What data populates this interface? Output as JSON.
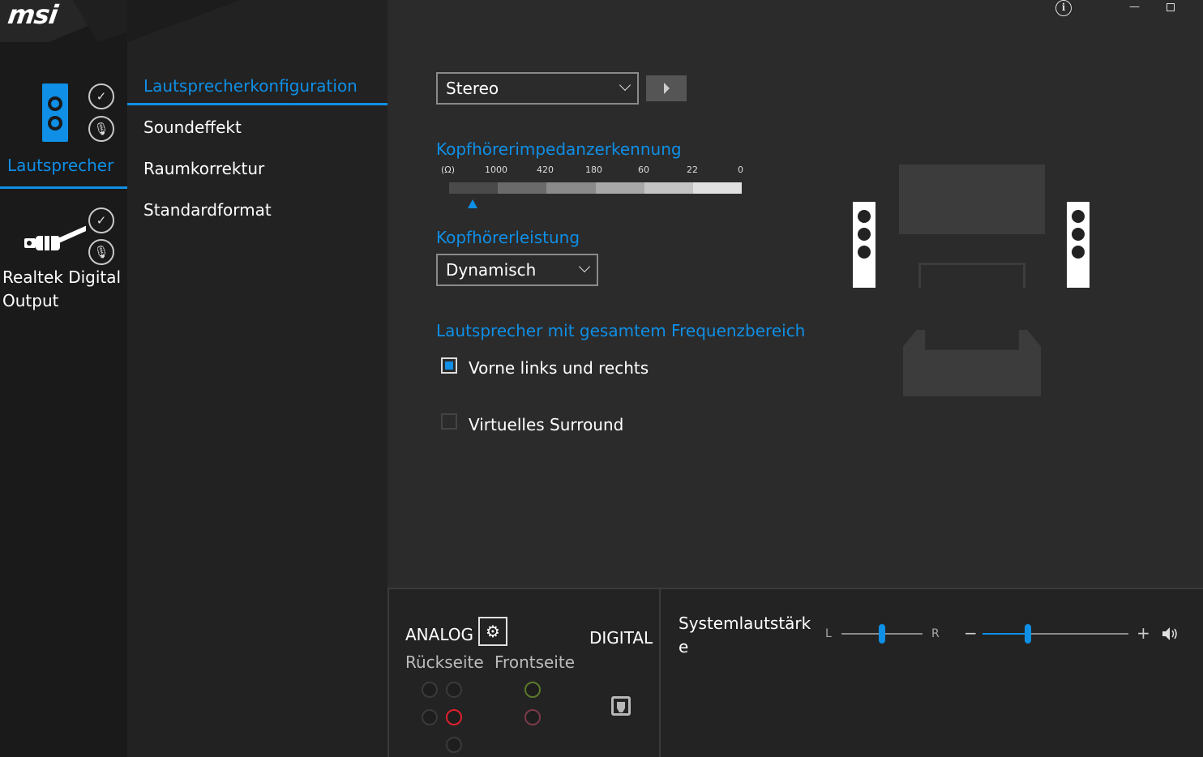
{
  "brand": {
    "logo": "msi",
    "accent": "#0f8fe6"
  },
  "devices": [
    {
      "label": "Lautsprecher",
      "active": true,
      "icon": "speaker-icon"
    },
    {
      "label": "Realtek Digital Output",
      "active": false,
      "icon": "digital-plug-icon"
    }
  ],
  "menu": {
    "items": [
      {
        "label": "Lautsprecherkonfiguration",
        "active": true
      },
      {
        "label": "Soundeffekt",
        "active": false
      },
      {
        "label": "Raumkorrektur",
        "active": false
      },
      {
        "label": "Standardformat",
        "active": false
      }
    ]
  },
  "config": {
    "speaker_select": "Stereo",
    "impedance_title": "Kopfhörerimpedanzerkennung",
    "impedance_scale": [
      "(Ω)",
      "1000",
      "420",
      "180",
      "60",
      "22",
      "0"
    ],
    "power_title": "Kopfhörerleistung",
    "power_select": "Dynamisch",
    "fullrange_title": "Lautsprecher mit gesamtem Frequenzbereich",
    "front_lr_label": "Vorne links und rechts",
    "front_lr_checked": true,
    "virtual_surround_label": "Virtuelles Surround",
    "virtual_surround_checked": false
  },
  "jacks": {
    "analog_label": "ANALOG",
    "digital_label": "DIGITAL",
    "rear_label": "Rückseite",
    "front_label": "Frontseite",
    "colors": {
      "active_red": "#e0212e",
      "green": "#5a7a2a",
      "pink": "#7a3a4a",
      "inactive": "#3a3a3a"
    }
  },
  "volume": {
    "label": "Systemlautstärk e",
    "balance_left": "L",
    "balance_right": "R",
    "minus": "−",
    "plus": "+",
    "balance_value": 0.5,
    "volume_value": 0.31
  }
}
